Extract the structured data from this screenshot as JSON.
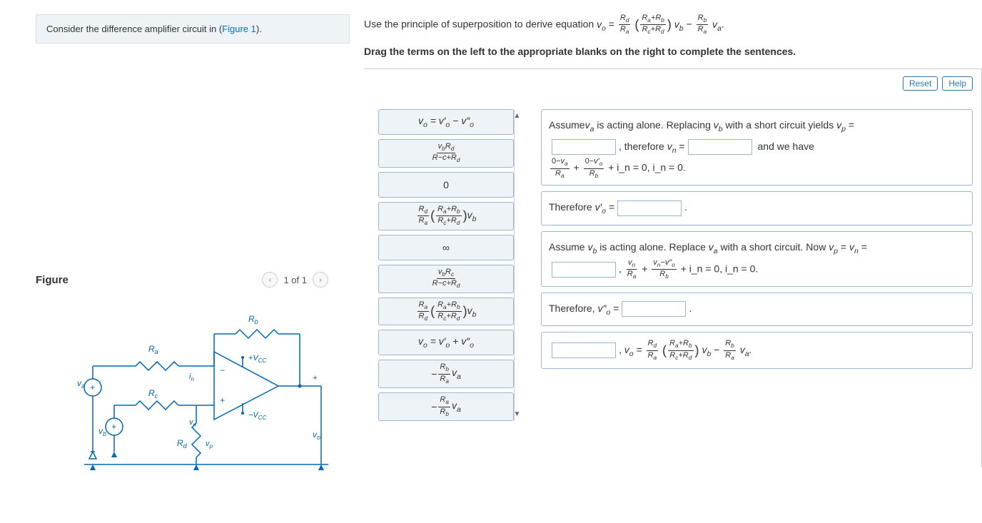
{
  "prompt": {
    "text_prefix": "Consider the difference amplifier circuit in (",
    "link": "Figure 1",
    "text_suffix": ")."
  },
  "figure": {
    "title": "Figure",
    "pager": "1 of 1"
  },
  "instruction_line": "Use the principle of superposition to derive equation ",
  "drag_instruction": "Drag the terms on the left to the appropriate blanks on the right to complete the sentences.",
  "buttons": {
    "reset": "Reset",
    "help": "Help"
  },
  "terms": [
    "v_o = v'_o − v''_o",
    "v_b R_d / (R−c+R_d)",
    "0",
    "(R_d/R_a)·((R_a+R_b)/(R_c+R_d))·v_b",
    "∞",
    "v_b R_c / (R−c+R_d)",
    "(R_a/R_d)·((R_a+R_b)/(R_c+R_d))·v_b",
    "v_o = v'_o + v''_o",
    "− (R_b/R_a) v_a",
    "− (R_a/R_b) v_a"
  ],
  "targets": {
    "t1": {
      "a": "Assume",
      "va": "v_a",
      "b": " is acting alone. Replacing ",
      "vb": "v_b",
      "c": " with a short circuit yields ",
      "vp": "v_p",
      "d": " ="
    },
    "row2": {
      "therefore": ", therefore ",
      "vn": "v_n",
      "andwehave": " and we have"
    },
    "eq1_tail": " + i_n = 0, i_n = 0.",
    "t2": "Therefore v'_o =",
    "t3": {
      "a": "Assume ",
      "vb": "v_b",
      "b": " is acting alone. Replace ",
      "va": "v_a",
      "c": " with a short circuit. Now ",
      "vp": "v_p",
      "d": " = ",
      "vn": "v_n",
      "e": " ="
    },
    "eq2_tail": " + i_n = 0, i_n = 0.",
    "t4": "Therefore, v''_o =",
    "t5_mid": ", v_o = "
  },
  "circuit_labels": {
    "Ra": "R_a",
    "Rb": "R_b",
    "Rc": "R_c",
    "Rd": "R_d",
    "in": "i_n",
    "vn": "v_n",
    "vp": "v_p",
    "va": "v_a",
    "vb": "v_b",
    "vo": "v_o",
    "pVcc": "+V_CC",
    "mVcc": "−V_CC"
  }
}
